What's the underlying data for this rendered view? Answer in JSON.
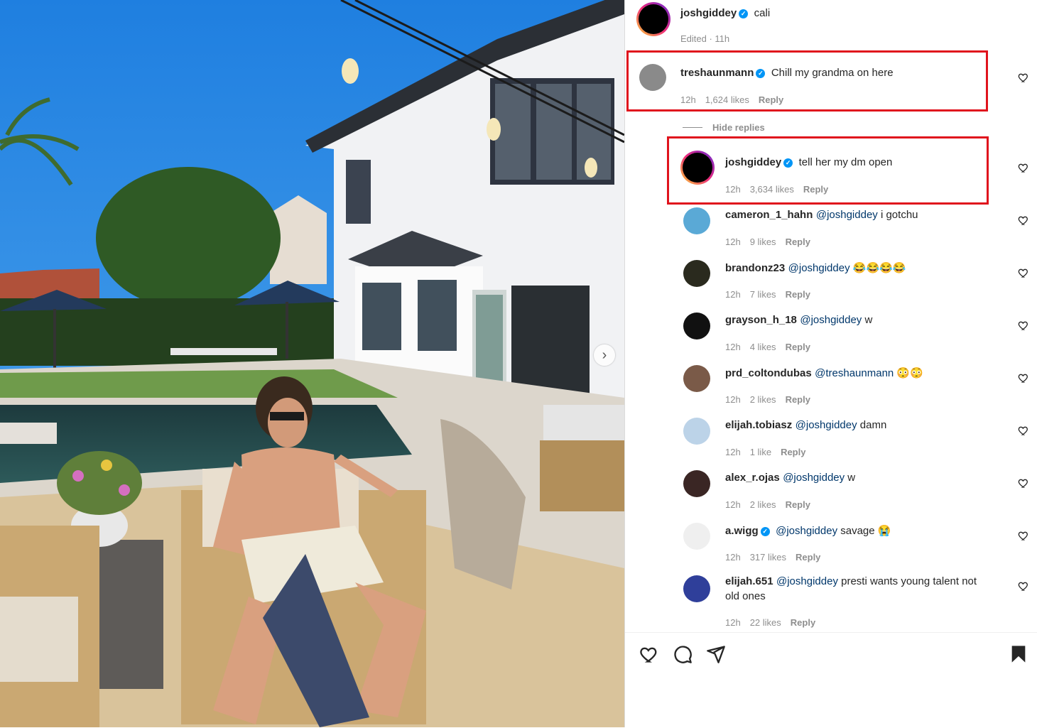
{
  "post": {
    "author": "joshgiddey",
    "caption": "cali",
    "edited": "Edited · 11h"
  },
  "hide_replies": "Hide replies",
  "comments": [
    {
      "user": "treshaunmann",
      "verified": true,
      "mention": "",
      "text": "Chill my grandma on here",
      "time": "12h",
      "likes": "1,624 likes",
      "reply": "Reply"
    },
    {
      "user": "joshgiddey",
      "verified": true,
      "mention": "",
      "text": "tell her my dm open",
      "time": "12h",
      "likes": "3,634 likes",
      "reply": "Reply"
    },
    {
      "user": "cameron_1_hahn",
      "verified": false,
      "mention": "@joshgiddey",
      "text": " i gotchu",
      "time": "12h",
      "likes": "9 likes",
      "reply": "Reply"
    },
    {
      "user": "brandonz23",
      "verified": false,
      "mention": "@joshgiddey",
      "text": " 😂😂😂😂",
      "time": "12h",
      "likes": "7 likes",
      "reply": "Reply"
    },
    {
      "user": "grayson_h_18",
      "verified": false,
      "mention": "@joshgiddey",
      "text": " w",
      "time": "12h",
      "likes": "4 likes",
      "reply": "Reply"
    },
    {
      "user": "prd_coltondubas",
      "verified": false,
      "mention": "@treshaunmann",
      "text": " 😳😳",
      "time": "12h",
      "likes": "2 likes",
      "reply": "Reply"
    },
    {
      "user": "elijah.tobiasz",
      "verified": false,
      "mention": "@joshgiddey",
      "text": " damn",
      "time": "12h",
      "likes": "1 like",
      "reply": "Reply"
    },
    {
      "user": "alex_r.ojas",
      "verified": false,
      "mention": "@joshgiddey",
      "text": " w",
      "time": "12h",
      "likes": "2 likes",
      "reply": "Reply"
    },
    {
      "user": "a.wigg",
      "verified": true,
      "mention": "@joshgiddey",
      "text": " savage 😭",
      "time": "12h",
      "likes": "317 likes",
      "reply": "Reply"
    },
    {
      "user": "elijah.651",
      "verified": false,
      "mention": "@joshgiddey",
      "text": " presti wants young talent not",
      "text2": "old ones",
      "time": "12h",
      "likes": "22 likes",
      "reply": "Reply"
    }
  ],
  "icons": {
    "like": "heart-icon",
    "comment": "comment-icon",
    "share": "send-icon",
    "save": "bookmark-icon",
    "next": "chevron-right-icon"
  },
  "colors": {
    "highlight_box": "#e0131d",
    "verified": "#0095f6",
    "mention": "#00376b"
  }
}
